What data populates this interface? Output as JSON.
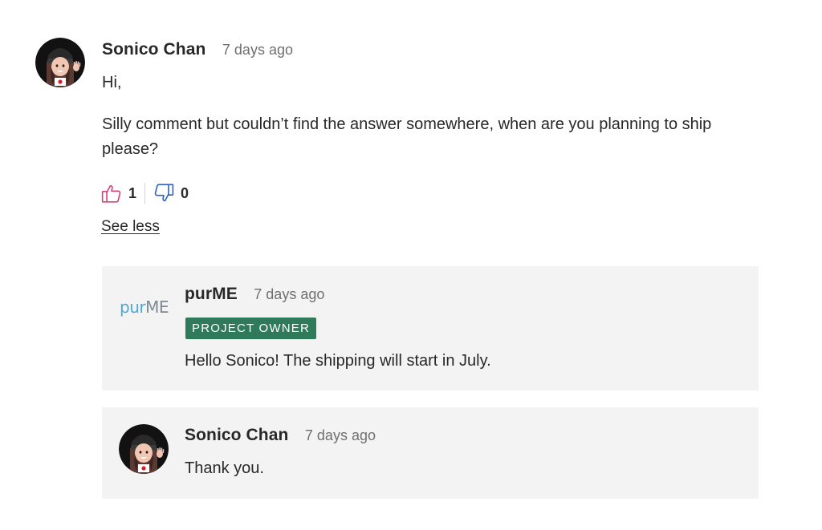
{
  "comment": {
    "author": "Sonico Chan",
    "time": "7 days ago",
    "greeting": "Hi,",
    "body": "Silly comment but couldn’t find the answer somewhere, when are you planning to ship please?",
    "likes": "1",
    "dislikes": "0",
    "see_less": "See less",
    "avatar_icon": "user-avatar-icon"
  },
  "replies": [
    {
      "author": "purME",
      "time": "7 days ago",
      "badge": "PROJECT OWNER",
      "text": "Hello Sonico! The shipping will start in July.",
      "logo": {
        "pur": "pur",
        "me": "ME"
      },
      "logo_colors": {
        "pur": "#4aa9d6",
        "me": "#7b8a93"
      }
    },
    {
      "author": "Sonico Chan",
      "time": "7 days ago",
      "text": "Thank you."
    }
  ],
  "colors": {
    "like": "#d9407a",
    "dislike": "#2d63c8",
    "badge_bg": "#2f7a5a",
    "reply_bg": "#f3f3f3"
  },
  "icons": {
    "like": "thumbs-up-icon",
    "dislike": "thumbs-down-icon"
  }
}
